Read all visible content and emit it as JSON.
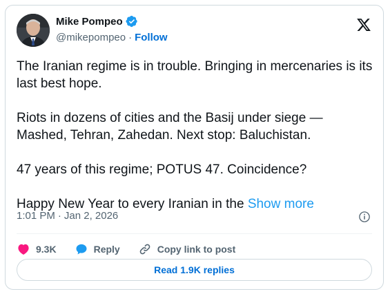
{
  "author": {
    "name": "Mike Pompeo",
    "handle": "@mikepompeo",
    "separator": "·",
    "follow_label": "Follow",
    "avatar_icon": "profile-photo",
    "verified_icon": "verified-badge-icon"
  },
  "brand_icon": "x-logo-icon",
  "tweet": {
    "paragraphs": [
      "The Iranian regime is in trouble. Bringing in mercenaries is its last best hope.",
      "Riots in dozens of cities and the Basij under siege — Mashed, Tehran, Zahedan.  Next stop:  Baluchistan.",
      "47 years of this regime; POTUS 47.  Coincidence?",
      "Happy New Year to every Iranian in the "
    ],
    "show_more_label": "Show more"
  },
  "meta": {
    "time": "1:01 PM",
    "separator": "·",
    "date": "Jan 2, 2026",
    "info_icon": "info-icon"
  },
  "actions": {
    "likes": "9.3K",
    "reply_label": "Reply",
    "copy_label": "Copy link to post"
  },
  "read_replies_label": "Read 1.9K replies",
  "colors": {
    "accent": "#1d9bf0",
    "link": "#006fd6",
    "like": "#f91880",
    "muted": "#536471",
    "text": "#0f1419",
    "border": "#cfd9de"
  }
}
